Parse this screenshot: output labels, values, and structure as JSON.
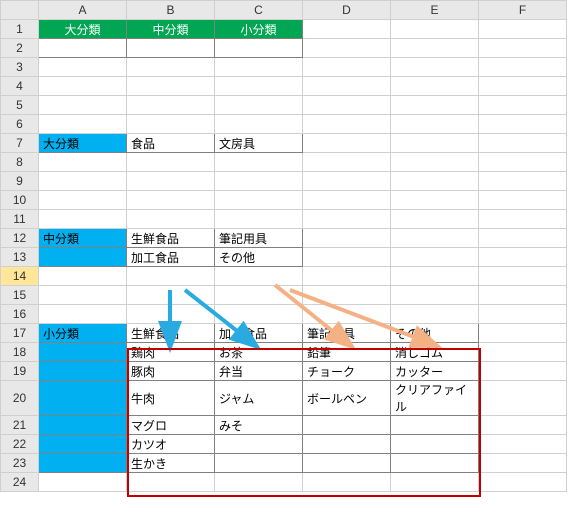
{
  "columns": [
    "A",
    "B",
    "C",
    "D",
    "E",
    "F"
  ],
  "rows": [
    "1",
    "2",
    "3",
    "4",
    "5",
    "6",
    "7",
    "8",
    "9",
    "10",
    "11",
    "12",
    "13",
    "14",
    "15",
    "16",
    "17",
    "18",
    "19",
    "20",
    "21",
    "22",
    "23",
    "24"
  ],
  "r1": {
    "A": "大分類",
    "B": "中分類",
    "C": "小分類"
  },
  "r7": {
    "A": "大分類",
    "B": "食品",
    "C": "文房具"
  },
  "r12": {
    "A": "中分類",
    "B": "生鮮食品",
    "C": "筆記用具"
  },
  "r13": {
    "B": "加工食品",
    "C": "その他"
  },
  "r17": {
    "A": "小分類",
    "B": "生鮮食品",
    "C": "加工食品",
    "D": "筆記用具",
    "E": "その他"
  },
  "r18": {
    "B": "鶏肉",
    "C": "お茶",
    "D": "鉛筆",
    "E": "消しゴム"
  },
  "r19": {
    "B": "豚肉",
    "C": "弁当",
    "D": "チョーク",
    "E": "カッター"
  },
  "r20": {
    "B": "牛肉",
    "C": "ジャム",
    "D": "ボールペン",
    "E": "クリアファイル"
  },
  "r21": {
    "B": "マグロ",
    "C": "みそ"
  },
  "r22": {
    "B": "カツオ"
  },
  "r23": {
    "B": "生かき"
  },
  "chart_data": {
    "type": "table",
    "title": "",
    "sections": [
      {
        "label": "大分類",
        "items": [
          "食品",
          "文房具"
        ]
      },
      {
        "label": "中分類",
        "groups": [
          {
            "parent": "食品",
            "items": [
              "生鮮食品",
              "加工食品"
            ]
          },
          {
            "parent": "文房具",
            "items": [
              "筆記用具",
              "その他"
            ]
          }
        ]
      },
      {
        "label": "小分類",
        "groups": [
          {
            "parent": "生鮮食品",
            "items": [
              "鶏肉",
              "豚肉",
              "牛肉",
              "マグロ",
              "カツオ",
              "生かき"
            ]
          },
          {
            "parent": "加工食品",
            "items": [
              "お茶",
              "弁当",
              "ジャム",
              "みそ"
            ]
          },
          {
            "parent": "筆記用具",
            "items": [
              "鉛筆",
              "チョーク",
              "ボールペン"
            ]
          },
          {
            "parent": "その他",
            "items": [
              "消しゴム",
              "カッター",
              "クリアファイル"
            ]
          }
        ]
      }
    ]
  }
}
